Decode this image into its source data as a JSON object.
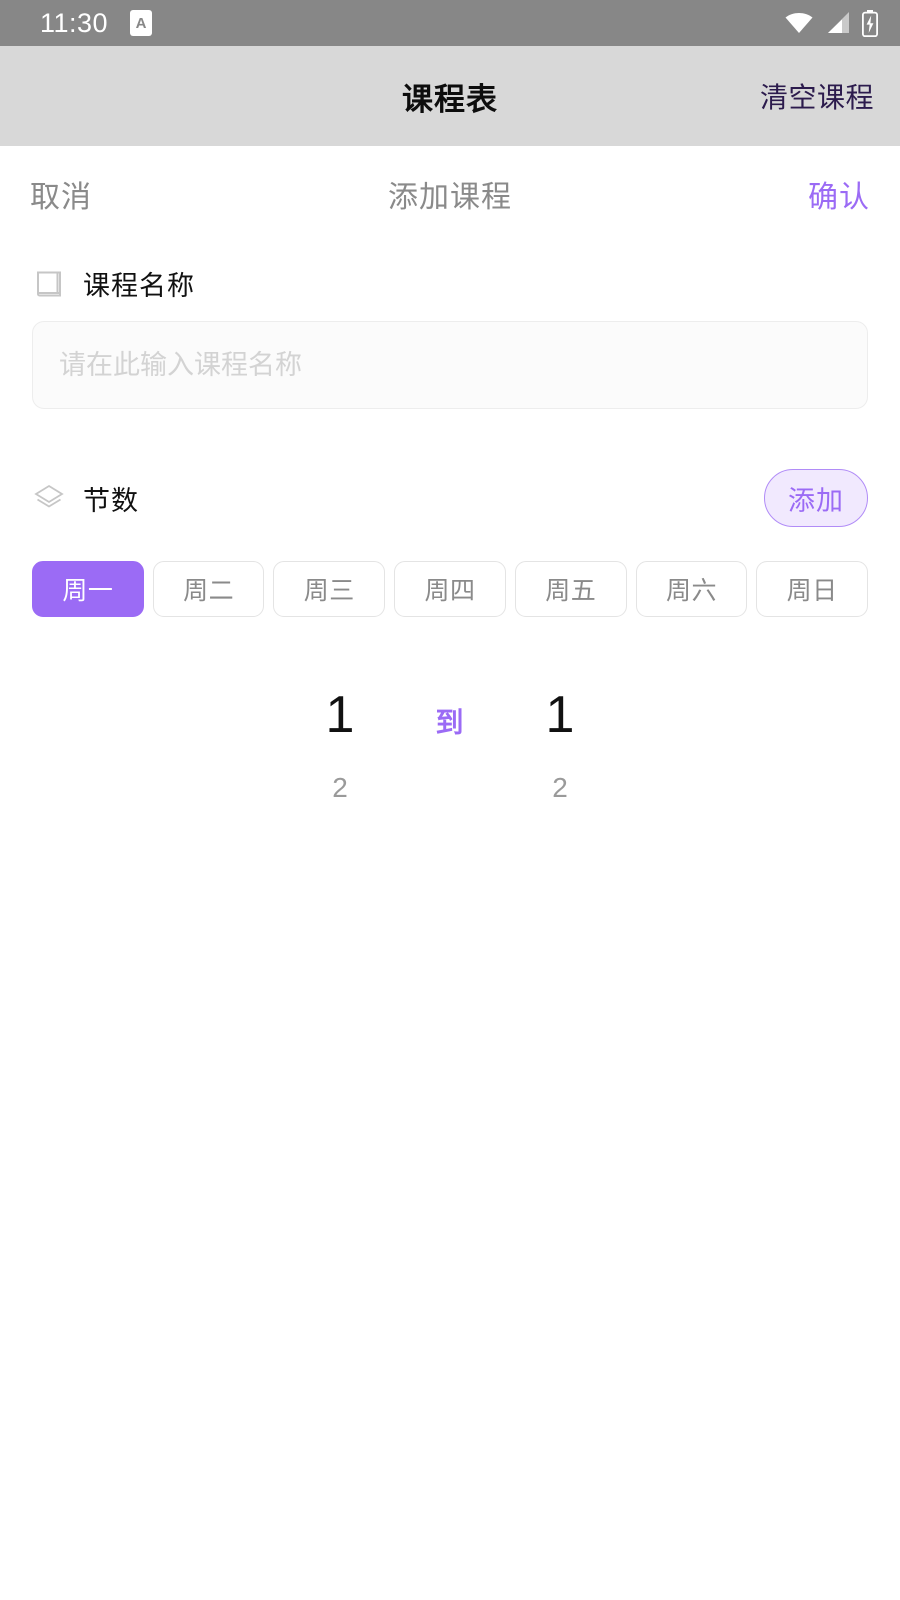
{
  "theme": {
    "accent_purple": "#9b6bf5",
    "accent_purple_soft": "#f1e9fe",
    "accent_purple_border": "#b18cf7",
    "header_bg": "#d8d8d8",
    "status_bar_bg": "#878787",
    "clear_action_color": "#2c1b4d",
    "muted_text": "#8a8a8a"
  },
  "status_bar": {
    "time": "11:30",
    "notification_letter": "A",
    "icons": [
      "wifi-icon",
      "cellular-signal-icon",
      "battery-charging-icon"
    ]
  },
  "app_header": {
    "title": "课程表",
    "clear_label": "清空课程"
  },
  "sheet": {
    "cancel_label": "取消",
    "title": "添加课程",
    "confirm_label": "确认"
  },
  "course_name": {
    "icon": "book-icon",
    "label": "课程名称",
    "value": "",
    "placeholder": "请在此输入课程名称"
  },
  "periods": {
    "icon": "layers-icon",
    "label": "节数",
    "add_label": "添加"
  },
  "day_tabs": {
    "selected_index": 0,
    "items": [
      {
        "label": "周一",
        "active": true
      },
      {
        "label": "周二",
        "active": false
      },
      {
        "label": "周三",
        "active": false
      },
      {
        "label": "周四",
        "active": false
      },
      {
        "label": "周五",
        "active": false
      },
      {
        "label": "周六",
        "active": false
      },
      {
        "label": "周日",
        "active": false
      }
    ]
  },
  "period_picker": {
    "separator_label": "到",
    "start": {
      "selected": "1",
      "next": "2"
    },
    "end": {
      "selected": "1",
      "next": "2"
    }
  }
}
